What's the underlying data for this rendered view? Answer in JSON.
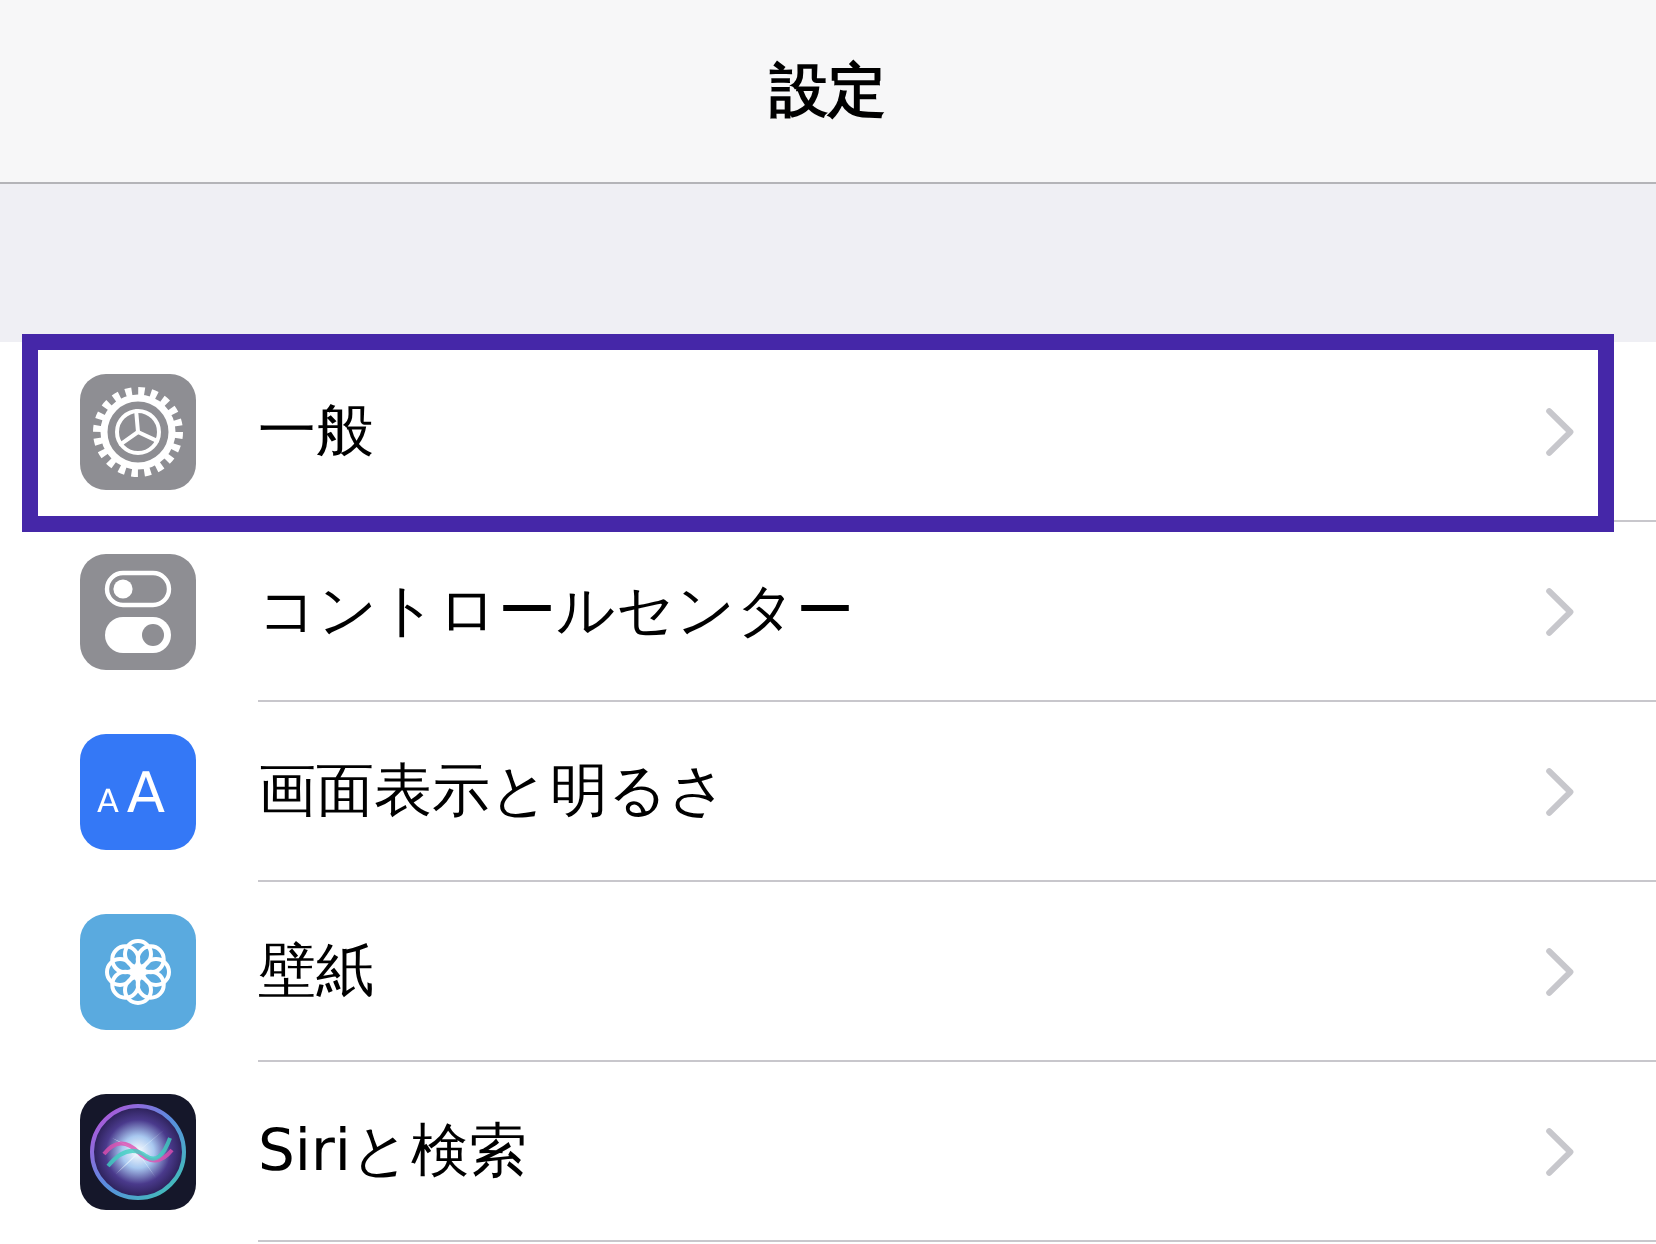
{
  "navigation_bar": {
    "title": "設定"
  },
  "settings": [
    {
      "label": "一般",
      "kind": "gear",
      "highlighted": true
    },
    {
      "label": "コントロールセンター",
      "kind": "toggles",
      "highlighted": false
    },
    {
      "label": "画面表示と明るさ",
      "kind": "text_size",
      "highlighted": false,
      "icon_letters": [
        "A",
        "A"
      ]
    },
    {
      "label": "壁紙",
      "kind": "flower",
      "highlighted": false
    },
    {
      "label": "Siriと検索",
      "kind": "siri",
      "highlighted": false
    }
  ]
}
